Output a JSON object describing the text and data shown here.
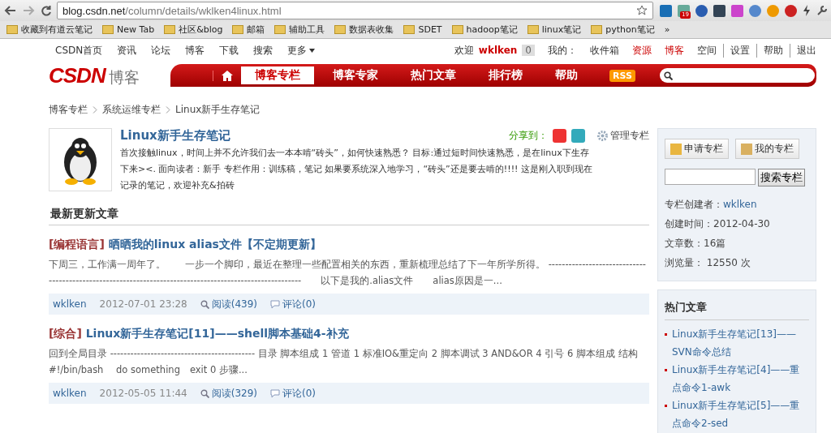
{
  "browser": {
    "url_host": "blog.csdn.net",
    "url_path": "/column/details/wklken4linux.html",
    "extension_badge": "19",
    "bookmarks": [
      "收藏到有道云笔记",
      "New Tab",
      "社区&blog",
      "邮箱",
      "辅助工具",
      "数据表收集",
      "SDET",
      "hadoop笔记",
      "linux笔记",
      "python笔记"
    ],
    "more": "»"
  },
  "topnav": {
    "links": [
      "CSDN首页",
      "资讯",
      "论坛",
      "博客",
      "下载",
      "搜索",
      "更多"
    ],
    "welcome": "欢迎",
    "user": "wklken",
    "count": "0",
    "mine": "我的：",
    "right_links": [
      {
        "label": "收件箱",
        "highlight": false
      },
      {
        "label": "资源",
        "highlight": true
      },
      {
        "label": "博客",
        "highlight": true
      },
      {
        "label": "空间",
        "highlight": false
      },
      {
        "label": "设置",
        "highlight": false
      },
      {
        "label": "帮助",
        "highlight": false
      },
      {
        "label": "退出",
        "highlight": false
      }
    ]
  },
  "banner": {
    "logo": "CSDN",
    "logo_sub": "博客",
    "tabs": [
      {
        "label": "博客专栏",
        "selected": true
      },
      {
        "label": "博客专家",
        "selected": false
      },
      {
        "label": "热门文章",
        "selected": false
      },
      {
        "label": "排行榜",
        "selected": false
      },
      {
        "label": "帮助",
        "selected": false
      }
    ],
    "rss": "RSS"
  },
  "breadcrumb": [
    "博客专栏",
    "系统运维专栏",
    "Linux新手生存笔记"
  ],
  "column": {
    "title": "Linux新手生存笔记",
    "share": "分享到：",
    "manage": "管理专栏",
    "description": "首次接触linux，时间上并不允许我们去一本本啃“砖头”，如何快速熟悉？ 目标:通过短时间快速熟悉，是在linux下生存下来><. 面向读者：新手 专栏作用：训练稿，笔记 如果要系统深入地学习，“砖头”还是要去啃的!!!! 这是刚入职到现在记录的笔记，欢迎补充&拍砖"
  },
  "section_title": "最新更新文章",
  "articles": [
    {
      "category": "[编程语言]",
      "title": "晒晒我的linux alias文件【不定期更新】",
      "summary": "下周三，工作满一周年了。　　一步一个脚印，最近在整理一些配置相关的东西，重新梳理总结了下一年所学所得。 --------------------------------------------------------------------------------------------------------　　以下是我的.alias文件　　alias原因是一...",
      "author": "wklken",
      "date": "2012-07-01 23:28",
      "reads": "阅读(439)",
      "comments": "评论(0)"
    },
    {
      "category": "[综合]",
      "title": "Linux新手生存笔记[11]——shell脚本基础4-补充",
      "summary": "回到全局目录 ------------------------------------------- 目录 脚本组成 1 管道 1 标准IO&重定向 2 脚本调试 3 AND&OR 4 引号 6 脚本组成 结构 #!/bin/bash　 do something　exit 0 步骤...",
      "author": "wklken",
      "date": "2012-05-05 11:44",
      "reads": "阅读(329)",
      "comments": "评论(0)"
    }
  ],
  "sidebar": {
    "apply": "申请专栏",
    "mine": "我的专栏",
    "search_button": "搜索专栏",
    "creator_label": "专栏创建者：",
    "creator": "wklken",
    "stats": [
      "创建时间：2012-04-30",
      "文章数：16篇",
      "浏览量： 12550 次"
    ],
    "hot_title": "热门文章",
    "hot": [
      "Linux新手生存笔记[13]——SVN命令总结",
      "Linux新手生存笔记[4]——重点命令1-awk",
      "Linux新手生存笔记[5]——重点命令2-sed"
    ]
  }
}
